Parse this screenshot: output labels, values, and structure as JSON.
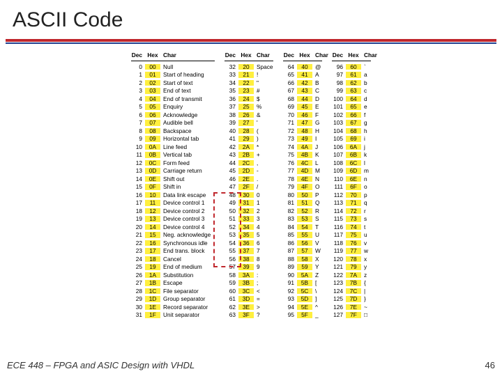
{
  "title": "ASCII Code",
  "footer_text": "ECE 448 – FPGA and ASIC Design with VHDL",
  "page_number": "46",
  "col_headers": {
    "dec": "Dec",
    "hex": "Hex",
    "char": "Char"
  },
  "chart_data": {
    "type": "table",
    "title": "ASCII Code",
    "columns": [
      "Dec",
      "Hex",
      "Char"
    ],
    "blocks": [
      [
        {
          "dec": "0",
          "hex": "00",
          "char": "Null"
        },
        {
          "dec": "1",
          "hex": "01",
          "char": "Start of heading"
        },
        {
          "dec": "2",
          "hex": "02",
          "char": "Start of text"
        },
        {
          "dec": "3",
          "hex": "03",
          "char": "End of text"
        },
        {
          "dec": "4",
          "hex": "04",
          "char": "End of transmit"
        },
        {
          "dec": "5",
          "hex": "05",
          "char": "Enquiry"
        },
        {
          "dec": "6",
          "hex": "06",
          "char": "Acknowledge"
        },
        {
          "dec": "7",
          "hex": "07",
          "char": "Audible bell"
        },
        {
          "dec": "8",
          "hex": "08",
          "char": "Backspace"
        },
        {
          "dec": "9",
          "hex": "09",
          "char": "Horizontal tab"
        },
        {
          "dec": "10",
          "hex": "0A",
          "char": "Line feed"
        },
        {
          "dec": "11",
          "hex": "0B",
          "char": "Vertical tab"
        },
        {
          "dec": "12",
          "hex": "0C",
          "char": "Form feed"
        },
        {
          "dec": "13",
          "hex": "0D",
          "char": "Carriage return"
        },
        {
          "dec": "14",
          "hex": "0E",
          "char": "Shift out"
        },
        {
          "dec": "15",
          "hex": "0F",
          "char": "Shift in"
        },
        {
          "dec": "16",
          "hex": "10",
          "char": "Data link escape"
        },
        {
          "dec": "17",
          "hex": "11",
          "char": "Device control 1"
        },
        {
          "dec": "18",
          "hex": "12",
          "char": "Device control 2"
        },
        {
          "dec": "19",
          "hex": "13",
          "char": "Device control 3"
        },
        {
          "dec": "20",
          "hex": "14",
          "char": "Device control 4"
        },
        {
          "dec": "21",
          "hex": "15",
          "char": "Neg. acknowledge"
        },
        {
          "dec": "22",
          "hex": "16",
          "char": "Synchronous idle"
        },
        {
          "dec": "23",
          "hex": "17",
          "char": "End trans. block"
        },
        {
          "dec": "24",
          "hex": "18",
          "char": "Cancel"
        },
        {
          "dec": "25",
          "hex": "19",
          "char": "End of medium"
        },
        {
          "dec": "26",
          "hex": "1A",
          "char": "Substitution"
        },
        {
          "dec": "27",
          "hex": "1B",
          "char": "Escape"
        },
        {
          "dec": "28",
          "hex": "1C",
          "char": "File separator"
        },
        {
          "dec": "29",
          "hex": "1D",
          "char": "Group separator"
        },
        {
          "dec": "30",
          "hex": "1E",
          "char": "Record separator"
        },
        {
          "dec": "31",
          "hex": "1F",
          "char": "Unit separator"
        }
      ],
      [
        {
          "dec": "32",
          "hex": "20",
          "char": "Space"
        },
        {
          "dec": "33",
          "hex": "21",
          "char": "!"
        },
        {
          "dec": "34",
          "hex": "22",
          "char": "\""
        },
        {
          "dec": "35",
          "hex": "23",
          "char": "#"
        },
        {
          "dec": "36",
          "hex": "24",
          "char": "$"
        },
        {
          "dec": "37",
          "hex": "25",
          "char": "%"
        },
        {
          "dec": "38",
          "hex": "26",
          "char": "&"
        },
        {
          "dec": "39",
          "hex": "27",
          "char": "'"
        },
        {
          "dec": "40",
          "hex": "28",
          "char": "("
        },
        {
          "dec": "41",
          "hex": "29",
          "char": ")"
        },
        {
          "dec": "42",
          "hex": "2A",
          "char": "*"
        },
        {
          "dec": "43",
          "hex": "2B",
          "char": "+"
        },
        {
          "dec": "44",
          "hex": "2C",
          "char": ","
        },
        {
          "dec": "45",
          "hex": "2D",
          "char": "-"
        },
        {
          "dec": "46",
          "hex": "2E",
          "char": "."
        },
        {
          "dec": "47",
          "hex": "2F",
          "char": "/"
        },
        {
          "dec": "48",
          "hex": "30",
          "char": "0"
        },
        {
          "dec": "49",
          "hex": "31",
          "char": "1"
        },
        {
          "dec": "50",
          "hex": "32",
          "char": "2"
        },
        {
          "dec": "51",
          "hex": "33",
          "char": "3"
        },
        {
          "dec": "52",
          "hex": "34",
          "char": "4"
        },
        {
          "dec": "53",
          "hex": "35",
          "char": "5"
        },
        {
          "dec": "54",
          "hex": "36",
          "char": "6"
        },
        {
          "dec": "55",
          "hex": "37",
          "char": "7"
        },
        {
          "dec": "56",
          "hex": "38",
          "char": "8"
        },
        {
          "dec": "57",
          "hex": "39",
          "char": "9"
        },
        {
          "dec": "58",
          "hex": "3A",
          "char": ":"
        },
        {
          "dec": "59",
          "hex": "3B",
          "char": ";"
        },
        {
          "dec": "60",
          "hex": "3C",
          "char": "<"
        },
        {
          "dec": "61",
          "hex": "3D",
          "char": "="
        },
        {
          "dec": "62",
          "hex": "3E",
          "char": ">"
        },
        {
          "dec": "63",
          "hex": "3F",
          "char": "?"
        }
      ],
      [
        {
          "dec": "64",
          "hex": "40",
          "char": "@"
        },
        {
          "dec": "65",
          "hex": "41",
          "char": "A"
        },
        {
          "dec": "66",
          "hex": "42",
          "char": "B"
        },
        {
          "dec": "67",
          "hex": "43",
          "char": "C"
        },
        {
          "dec": "68",
          "hex": "44",
          "char": "D"
        },
        {
          "dec": "69",
          "hex": "45",
          "char": "E"
        },
        {
          "dec": "70",
          "hex": "46",
          "char": "F"
        },
        {
          "dec": "71",
          "hex": "47",
          "char": "G"
        },
        {
          "dec": "72",
          "hex": "48",
          "char": "H"
        },
        {
          "dec": "73",
          "hex": "49",
          "char": "I"
        },
        {
          "dec": "74",
          "hex": "4A",
          "char": "J"
        },
        {
          "dec": "75",
          "hex": "4B",
          "char": "K"
        },
        {
          "dec": "76",
          "hex": "4C",
          "char": "L"
        },
        {
          "dec": "77",
          "hex": "4D",
          "char": "M"
        },
        {
          "dec": "78",
          "hex": "4E",
          "char": "N"
        },
        {
          "dec": "79",
          "hex": "4F",
          "char": "O"
        },
        {
          "dec": "80",
          "hex": "50",
          "char": "P"
        },
        {
          "dec": "81",
          "hex": "51",
          "char": "Q"
        },
        {
          "dec": "82",
          "hex": "52",
          "char": "R"
        },
        {
          "dec": "83",
          "hex": "53",
          "char": "S"
        },
        {
          "dec": "84",
          "hex": "54",
          "char": "T"
        },
        {
          "dec": "85",
          "hex": "55",
          "char": "U"
        },
        {
          "dec": "86",
          "hex": "56",
          "char": "V"
        },
        {
          "dec": "87",
          "hex": "57",
          "char": "W"
        },
        {
          "dec": "88",
          "hex": "58",
          "char": "X"
        },
        {
          "dec": "89",
          "hex": "59",
          "char": "Y"
        },
        {
          "dec": "90",
          "hex": "5A",
          "char": "Z"
        },
        {
          "dec": "91",
          "hex": "5B",
          "char": "["
        },
        {
          "dec": "92",
          "hex": "5C",
          "char": "\\"
        },
        {
          "dec": "93",
          "hex": "5D",
          "char": "]"
        },
        {
          "dec": "94",
          "hex": "5E",
          "char": "^"
        },
        {
          "dec": "95",
          "hex": "5F",
          "char": "_"
        }
      ],
      [
        {
          "dec": "96",
          "hex": "60",
          "char": "`"
        },
        {
          "dec": "97",
          "hex": "61",
          "char": "a"
        },
        {
          "dec": "98",
          "hex": "62",
          "char": "b"
        },
        {
          "dec": "99",
          "hex": "63",
          "char": "c"
        },
        {
          "dec": "100",
          "hex": "64",
          "char": "d"
        },
        {
          "dec": "101",
          "hex": "65",
          "char": "e"
        },
        {
          "dec": "102",
          "hex": "66",
          "char": "f"
        },
        {
          "dec": "103",
          "hex": "67",
          "char": "g"
        },
        {
          "dec": "104",
          "hex": "68",
          "char": "h"
        },
        {
          "dec": "105",
          "hex": "69",
          "char": "i"
        },
        {
          "dec": "106",
          "hex": "6A",
          "char": "j"
        },
        {
          "dec": "107",
          "hex": "6B",
          "char": "k"
        },
        {
          "dec": "108",
          "hex": "6C",
          "char": "l"
        },
        {
          "dec": "109",
          "hex": "6D",
          "char": "m"
        },
        {
          "dec": "110",
          "hex": "6E",
          "char": "n"
        },
        {
          "dec": "111",
          "hex": "6F",
          "char": "o"
        },
        {
          "dec": "112",
          "hex": "70",
          "char": "p"
        },
        {
          "dec": "113",
          "hex": "71",
          "char": "q"
        },
        {
          "dec": "114",
          "hex": "72",
          "char": "r"
        },
        {
          "dec": "115",
          "hex": "73",
          "char": "s"
        },
        {
          "dec": "116",
          "hex": "74",
          "char": "t"
        },
        {
          "dec": "117",
          "hex": "75",
          "char": "u"
        },
        {
          "dec": "118",
          "hex": "76",
          "char": "v"
        },
        {
          "dec": "119",
          "hex": "77",
          "char": "w"
        },
        {
          "dec": "120",
          "hex": "78",
          "char": "x"
        },
        {
          "dec": "121",
          "hex": "79",
          "char": "y"
        },
        {
          "dec": "122",
          "hex": "7A",
          "char": "z"
        },
        {
          "dec": "123",
          "hex": "7B",
          "char": "{"
        },
        {
          "dec": "124",
          "hex": "7C",
          "char": "|"
        },
        {
          "dec": "125",
          "hex": "7D",
          "char": "}"
        },
        {
          "dec": "126",
          "hex": "7E",
          "char": "~"
        },
        {
          "dec": "127",
          "hex": "7F",
          "char": "□"
        }
      ]
    ]
  }
}
